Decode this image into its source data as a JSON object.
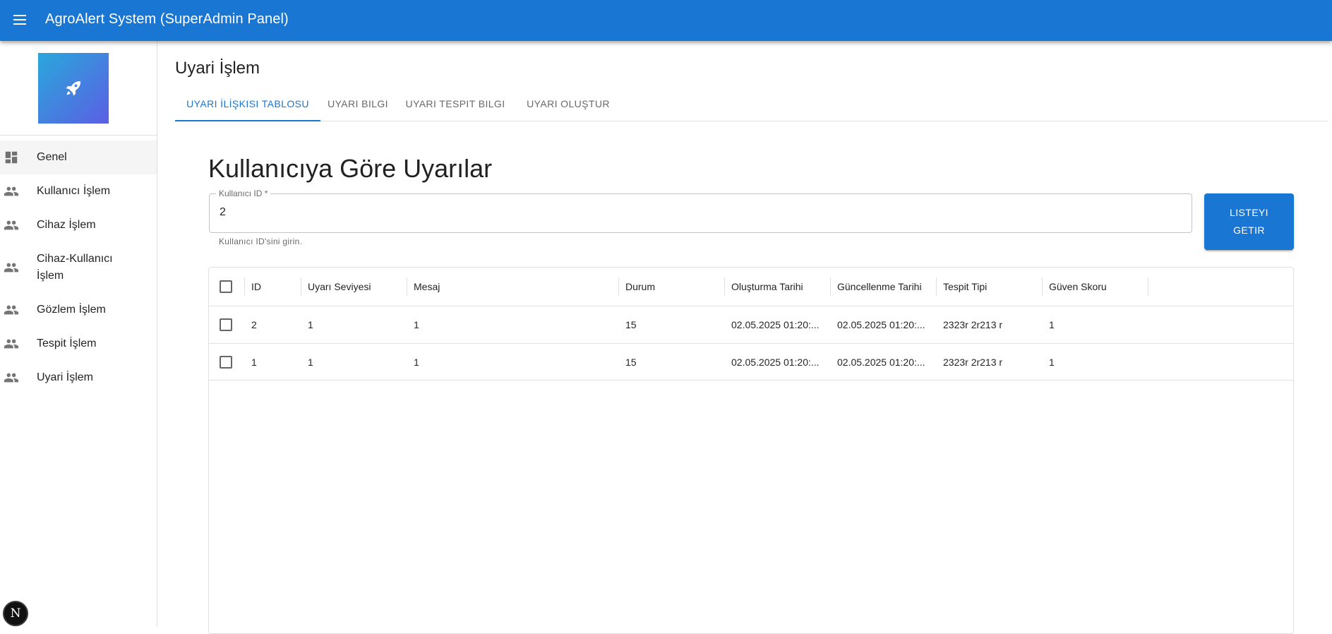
{
  "app": {
    "title": "AgroAlert System (SuperAdmin Panel)"
  },
  "sidebar": {
    "items": [
      {
        "label": "Genel",
        "icon": "dashboard-icon"
      },
      {
        "label": "Kullanıcı İşlem",
        "icon": "people-icon"
      },
      {
        "label": "Cihaz İşlem",
        "icon": "people-icon"
      },
      {
        "label": "Cihaz-Kullanıcı İşlem",
        "icon": "people-icon"
      },
      {
        "label": "Gözlem İşlem",
        "icon": "people-icon"
      },
      {
        "label": "Tespit İşlem",
        "icon": "people-icon"
      },
      {
        "label": "Uyari İşlem",
        "icon": "people-icon"
      }
    ],
    "logo_icon": "rocket-icon",
    "badge": "N"
  },
  "page": {
    "title": "Uyari İşlem",
    "tabs": [
      {
        "label": "UYARI İLİŞKISI TABLOSU"
      },
      {
        "label": "UYARI BILGI"
      },
      {
        "label": "UYARI TESPIT BILGI"
      },
      {
        "label": "UYARI OLUŞTUR"
      }
    ]
  },
  "section": {
    "title": "Kullanıcıya Göre Uyarılar",
    "user_id_label": "Kullanıcı ID *",
    "user_id_value": "2",
    "helper_text": "Kullanıcı ID'sini girin.",
    "fetch_button": "LISTEYI GETIR"
  },
  "table": {
    "columns": [
      "ID",
      "Uyarı Seviyesi",
      "Mesaj",
      "Durum",
      "Oluşturma Tarihi",
      "Güncellenme Tarihi",
      "Tespit Tipi",
      "Güven Skoru"
    ],
    "rows": [
      [
        "2",
        "1",
        "1",
        "15",
        "02.05.2025 01:20:...",
        "02.05.2025 01:20:...",
        "2323r 2r213 r",
        "1"
      ],
      [
        "1",
        "1",
        "1",
        "15",
        "02.05.2025 01:20:...",
        "02.05.2025 01:20:...",
        "2323r 2r213 r",
        "1"
      ]
    ]
  },
  "colors": {
    "primary": "#1976d2",
    "logo_gradient_start": "#2aa7dc",
    "logo_gradient_end": "#5b5fe3"
  }
}
